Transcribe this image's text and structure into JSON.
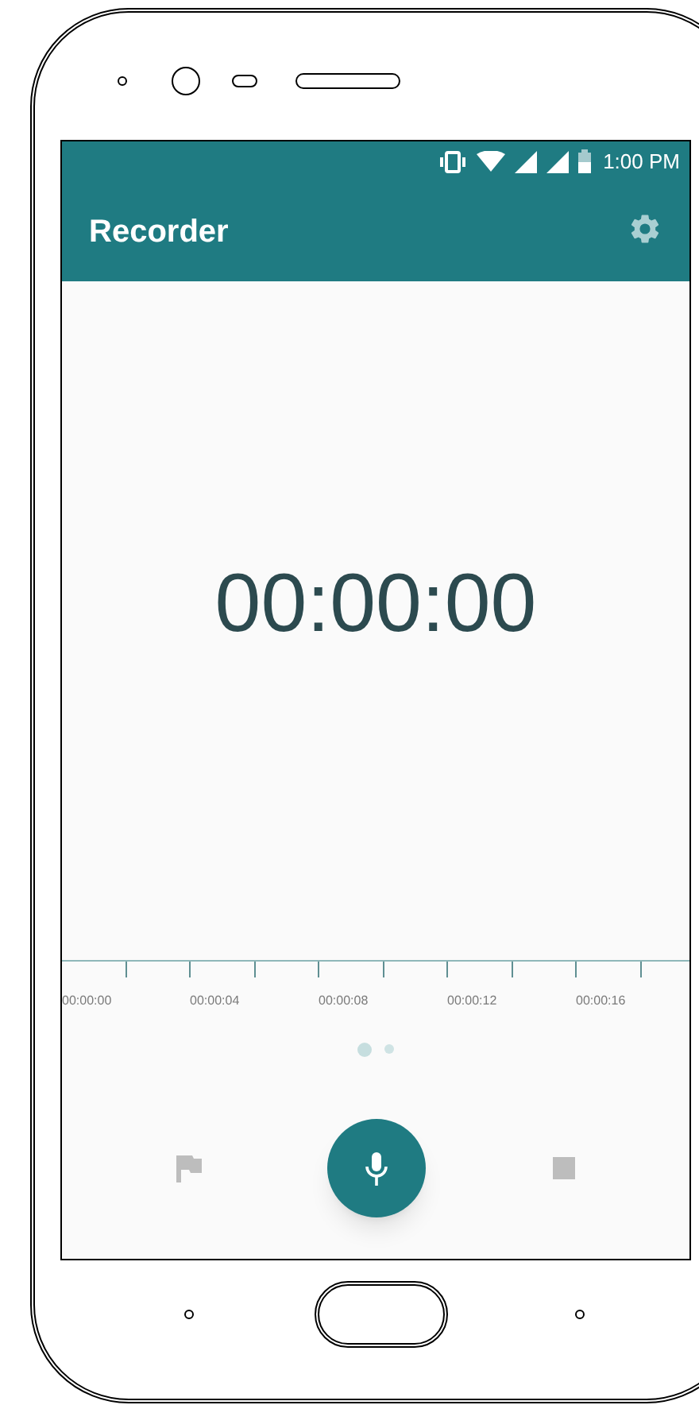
{
  "status_bar": {
    "time": "1:00 PM"
  },
  "app_bar": {
    "title": "Recorder"
  },
  "timer": "00:00:00",
  "timeline": {
    "labels": [
      "00:00:00",
      "00:00:04",
      "00:00:08",
      "00:00:12",
      "00:00:16"
    ]
  },
  "page_indicator": [
    {
      "selected": true
    },
    {
      "selected": false
    }
  ],
  "controls": [
    {
      "kind": "flag",
      "disabled": true
    },
    {
      "kind": "record",
      "disabled": false
    },
    {
      "kind": "stop",
      "disabled": true
    }
  ]
}
